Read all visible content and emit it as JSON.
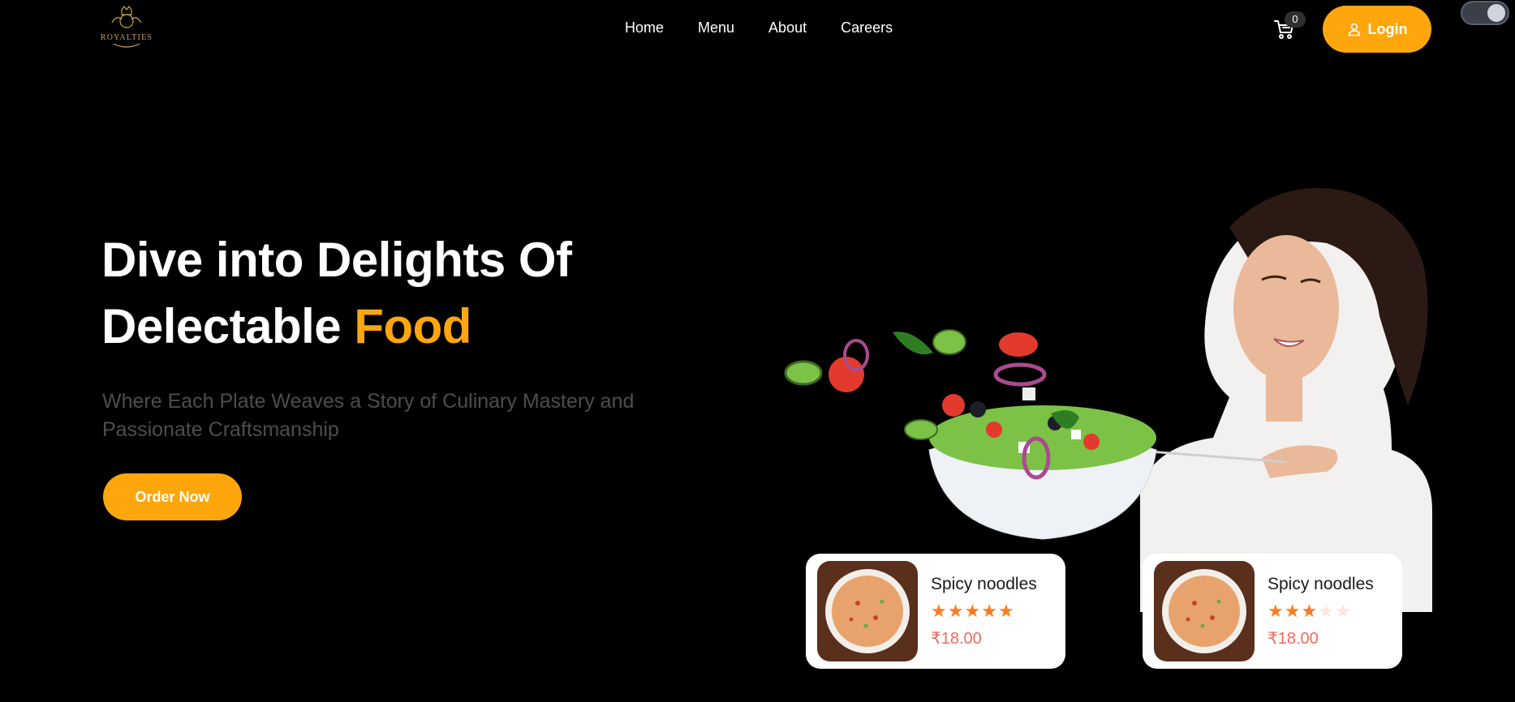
{
  "header": {
    "logo_text": "ROYALTIES",
    "nav": [
      "Home",
      "Menu",
      "About",
      "Careers"
    ],
    "cart_count": "0",
    "login_label": "Login"
  },
  "hero": {
    "headline_line1": "Dive into Delights Of",
    "headline_line2": "Delectable",
    "headline_accent": "Food",
    "subtitle": "Where Each Plate Weaves a Story of Culinary Mastery and Passionate Craftsmanship",
    "cta_label": "Order Now"
  },
  "cards": [
    {
      "name": "Spicy noodles",
      "rating": 5,
      "max_rating": 5,
      "price": "₹18.00"
    },
    {
      "name": "Spicy noodles",
      "rating": 3,
      "max_rating": 5,
      "price": "₹18.00"
    }
  ],
  "colors": {
    "accent": "#ffa60d",
    "background": "#000000",
    "price": "#f06a5a",
    "star": "#ff7a1a"
  },
  "icons": [
    "logo-crest-icon",
    "cart-icon",
    "user-icon",
    "theme-toggle-icon",
    "star-icon"
  ]
}
